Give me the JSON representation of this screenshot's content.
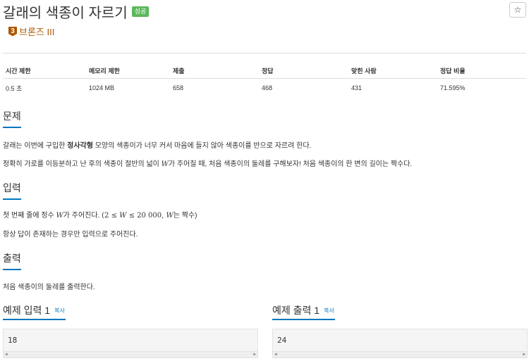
{
  "problem": {
    "title": "갈래의 색종이 자르기",
    "result_badge": "성공",
    "star_icon": "☆",
    "tier": {
      "number": "3",
      "name": "브론즈 III"
    }
  },
  "info_table": {
    "headers": [
      "시간 제한",
      "메모리 제한",
      "제출",
      "정답",
      "맞힌 사람",
      "정답 비율"
    ],
    "values": [
      "0.5 초",
      "1024 MB",
      "658",
      "468",
      "431",
      "71.595%"
    ]
  },
  "sections": {
    "description": {
      "title": "문제",
      "p1_a": "갈래는 이번에 구입한 ",
      "p1_bold": "정사각형",
      "p1_b": " 모양의 색종이가 너무 커서 마음에 들지 않아 색종이를 반으로 자르려 한다.",
      "p2_a": "정확히 가로를 이등분하고 난 후의 색종이 절반의 넓이 ",
      "p2_var": "W",
      "p2_b": "가 주어질 때, 처음 색종이의 둘레를 구해보자! 처음 색종이의 한 변의 길이는 짝수다."
    },
    "input": {
      "title": "입력",
      "p1_a": "첫 번째 줄에 정수 ",
      "p1_var": "W",
      "p1_b": "가 주어진다. ",
      "p1_math_a": "(2 ≤ ",
      "p1_math_var": "W",
      "p1_math_b": " ≤ 20 000, ",
      "p1_math_var2": "W",
      "p1_math_c": "는 짝수)",
      "p2": "항상 답이 존재하는 경우만 입력으로 주어진다."
    },
    "output": {
      "title": "출력",
      "p1": "처음 색종이의 둘레를 출력한다."
    }
  },
  "examples": {
    "input_title": "예제 입력 1",
    "output_title": "예제 출력 1",
    "copy_label": "복사",
    "input_value": "18",
    "output_value": "24"
  },
  "colors": {
    "accent": "#0076c0",
    "success": "#5cb85c",
    "bronze": "#ad5600"
  }
}
